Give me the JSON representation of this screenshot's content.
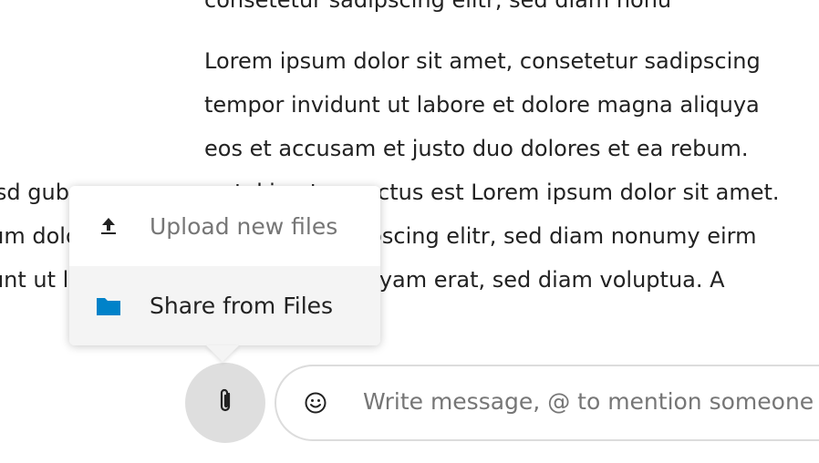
{
  "message": {
    "lines": [
      "consetetur sadipscing elitr, sed diam nonu",
      "Lorem ipsum dolor sit amet, consetetur sadipscing",
      "tempor invidunt ut labore et dolore magna aliquya",
      "eos et accusam et justo duo dolores et ea rebum.",
      "Stet clita kasd gubergren, no sea takimata sanctus est Lorem ipsum dolor sit amet.",
      "Lorem ipsum dolor sit amet, consetetur sadipscing elitr, sed diam nonumy eirm",
      "tempor invidunt ut labore et dolore magna aliquyam erat, sed diam voluptua. A"
    ]
  },
  "attach_menu": {
    "items": [
      {
        "label": "Upload new files",
        "icon": "upload-icon"
      },
      {
        "label": "Share from Files",
        "icon": "folder-icon",
        "icon_color": "#0082c9"
      }
    ]
  },
  "composer": {
    "attach_icon": "paperclip-icon",
    "emoji_icon": "emoji-icon",
    "placeholder": "Write message, @ to mention someone …"
  }
}
